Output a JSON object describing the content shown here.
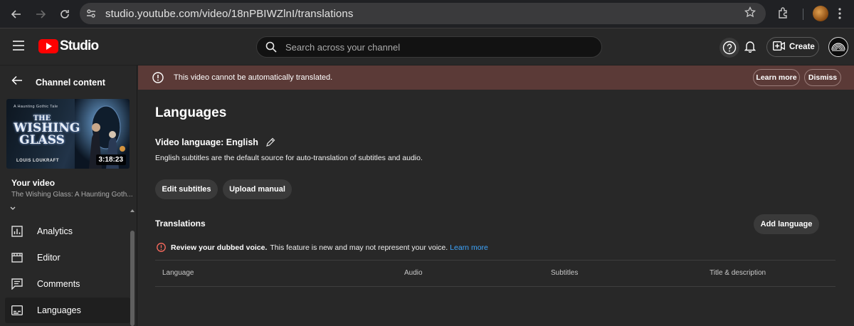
{
  "browser": {
    "url": "studio.youtube.com/video/18nPBIWZlnI/translations"
  },
  "header": {
    "logo_text": "Studio",
    "search_placeholder": "Search across your channel",
    "create_label": "Create"
  },
  "sidebar": {
    "back_label": "Channel content",
    "thumbnail": {
      "subtitle": "A Haunting Gothic Tale",
      "title_line1": "THE",
      "title_line2": "WISHING",
      "title_line3": "GLASS",
      "author": "LOUIS LOUKRAFT",
      "duration": "3:18:23"
    },
    "your_video_label": "Your video",
    "video_title": "The Wishing Glass: A Haunting Goth...",
    "items": [
      {
        "label": "Analytics",
        "icon": "analytics-icon"
      },
      {
        "label": "Editor",
        "icon": "editor-icon"
      },
      {
        "label": "Comments",
        "icon": "comments-icon"
      },
      {
        "label": "Languages",
        "icon": "languages-icon",
        "active": true
      }
    ]
  },
  "banner": {
    "message": "This video cannot be automatically translated.",
    "learn_more": "Learn more",
    "dismiss": "Dismiss",
    "color": "#5b3a37"
  },
  "main": {
    "title": "Languages",
    "video_language": "Video language: English",
    "description": "English subtitles are the default source for auto-translation of subtitles and audio.",
    "edit_subtitles": "Edit subtitles",
    "upload_manual": "Upload manual",
    "translations_label": "Translations",
    "add_language": "Add language",
    "dub_notice": {
      "strong": "Review your dubbed voice.",
      "text": "This feature is new and may not represent your voice.",
      "link": "Learn more"
    },
    "table_headers": [
      "Language",
      "Audio",
      "Subtitles",
      "Title & description"
    ]
  },
  "colors": {
    "background": "#282828",
    "accent_link": "#3ea6ff",
    "brand_red": "#ff0000",
    "warning": "#ff6b5e"
  }
}
